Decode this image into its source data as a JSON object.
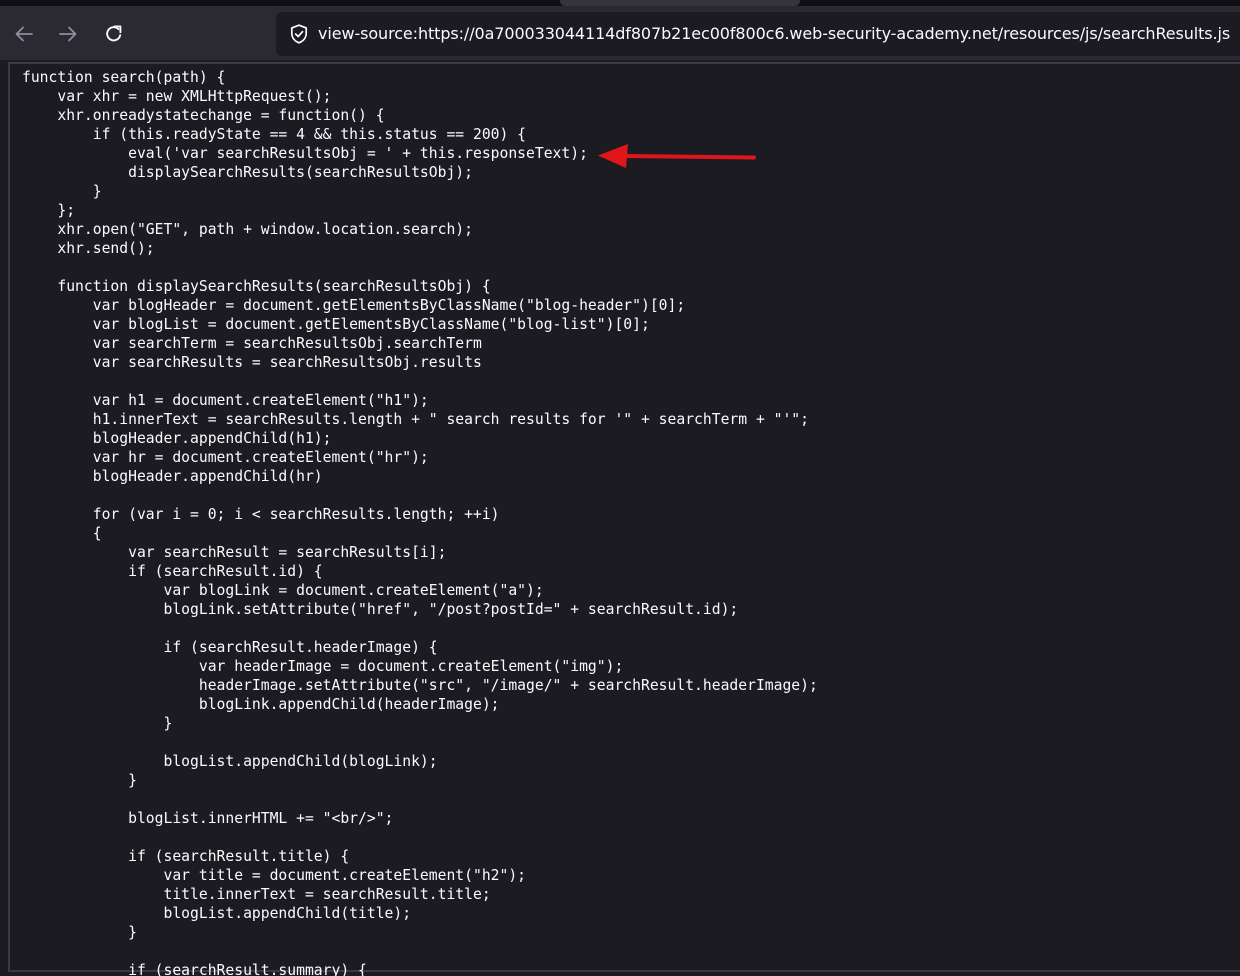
{
  "browser": {
    "url_scheme": "view-source:",
    "url_host": "https://0a700033044114df807b21ec00f800c6.web-security-academy.net",
    "url_path": "/resources/js/searchResults.js",
    "icons": {
      "back": "back-arrow-icon",
      "forward": "forward-arrow-icon",
      "reload": "reload-icon",
      "security": "shield-check-icon"
    }
  },
  "source": {
    "lines": [
      "function search(path) {",
      "    var xhr = new XMLHttpRequest();",
      "    xhr.onreadystatechange = function() {",
      "        if (this.readyState == 4 && this.status == 200) {",
      "            eval('var searchResultsObj = ' + this.responseText);",
      "            displaySearchResults(searchResultsObj);",
      "        }",
      "    };",
      "    xhr.open(\"GET\", path + window.location.search);",
      "    xhr.send();",
      "",
      "    function displaySearchResults(searchResultsObj) {",
      "        var blogHeader = document.getElementsByClassName(\"blog-header\")[0];",
      "        var blogList = document.getElementsByClassName(\"blog-list\")[0];",
      "        var searchTerm = searchResultsObj.searchTerm",
      "        var searchResults = searchResultsObj.results",
      "",
      "        var h1 = document.createElement(\"h1\");",
      "        h1.innerText = searchResults.length + \" search results for '\" + searchTerm + \"'\";",
      "        blogHeader.appendChild(h1);",
      "        var hr = document.createElement(\"hr\");",
      "        blogHeader.appendChild(hr)",
      "",
      "        for (var i = 0; i < searchResults.length; ++i)",
      "        {",
      "            var searchResult = searchResults[i];",
      "            if (searchResult.id) {",
      "                var blogLink = document.createElement(\"a\");",
      "                blogLink.setAttribute(\"href\", \"/post?postId=\" + searchResult.id);",
      "",
      "                if (searchResult.headerImage) {",
      "                    var headerImage = document.createElement(\"img\");",
      "                    headerImage.setAttribute(\"src\", \"/image/\" + searchResult.headerImage);",
      "                    blogLink.appendChild(headerImage);",
      "                }",
      "",
      "                blogList.appendChild(blogLink);",
      "            }",
      "",
      "            blogList.innerHTML += \"<br/>\";",
      "",
      "            if (searchResult.title) {",
      "                var title = document.createElement(\"h2\");",
      "                title.innerText = searchResult.title;",
      "                blogList.appendChild(title);",
      "            }",
      "",
      "            if (searchResult.summary) {"
    ]
  },
  "annotation": {
    "color": "#e0161b",
    "target_line": 4
  }
}
